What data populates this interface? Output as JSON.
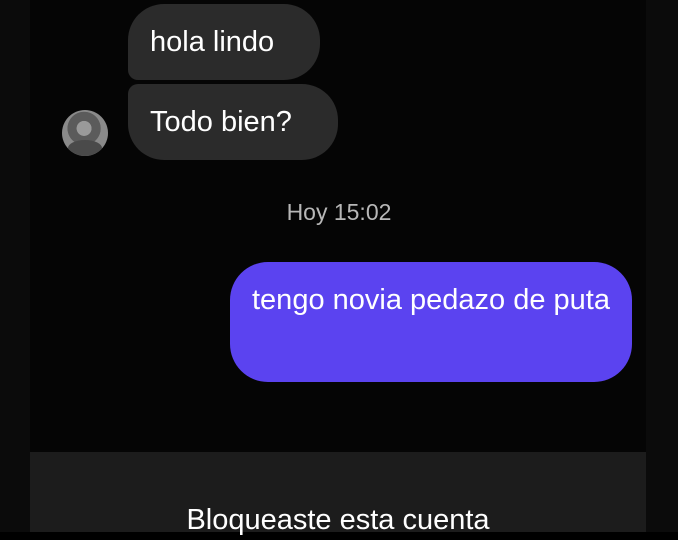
{
  "messages": {
    "incoming": [
      {
        "text": "hola lindo"
      },
      {
        "text": "Todo bien?"
      }
    ],
    "timestamp": "Hoy 15:02",
    "outgoing": [
      {
        "text": "tengo novia pedazo de puta"
      }
    ]
  },
  "footer": {
    "blocked_text": "Bloqueaste esta cuenta"
  },
  "colors": {
    "background": "#050505",
    "incoming_bubble": "#2b2b2b",
    "outgoing_bubble": "#5b43f0",
    "footer_bar": "#1c1c1c"
  },
  "icons": {
    "avatar": "profile-avatar"
  }
}
